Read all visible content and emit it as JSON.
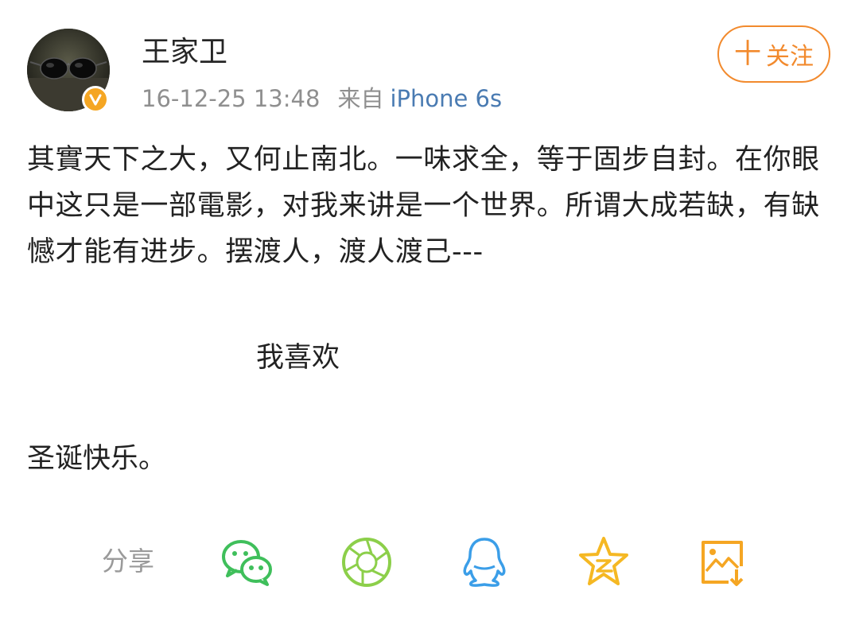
{
  "header": {
    "username": "王家卫",
    "timestamp": "16-12-25 13:48",
    "source_prefix": "来自",
    "device": "iPhone 6s",
    "follow_label": "关注",
    "follow_plus": "十"
  },
  "post": {
    "paragraph_1": "其實天下之大，又何止南北。一味求全，等于固步自封。在你眼中这只是一部電影，对我来讲是一个世界。所谓大成若缺，有缺憾才能有进步。摆渡人，渡人渡己---",
    "line_2": "我喜欢",
    "line_3": "圣诞快乐。"
  },
  "share": {
    "label": "分享",
    "icons": [
      "wechat-icon",
      "moments-icon",
      "qq-icon",
      "qzone-icon",
      "save-image-icon"
    ]
  },
  "colors": {
    "accent": "#f28a2d",
    "link": "#4a7bb2",
    "muted": "#8f8f8f",
    "wechat": "#3fbf5b",
    "moments": "#8ccf4a",
    "qq": "#3b9ee8",
    "qzone": "#f5b823",
    "save": "#f5a623"
  }
}
